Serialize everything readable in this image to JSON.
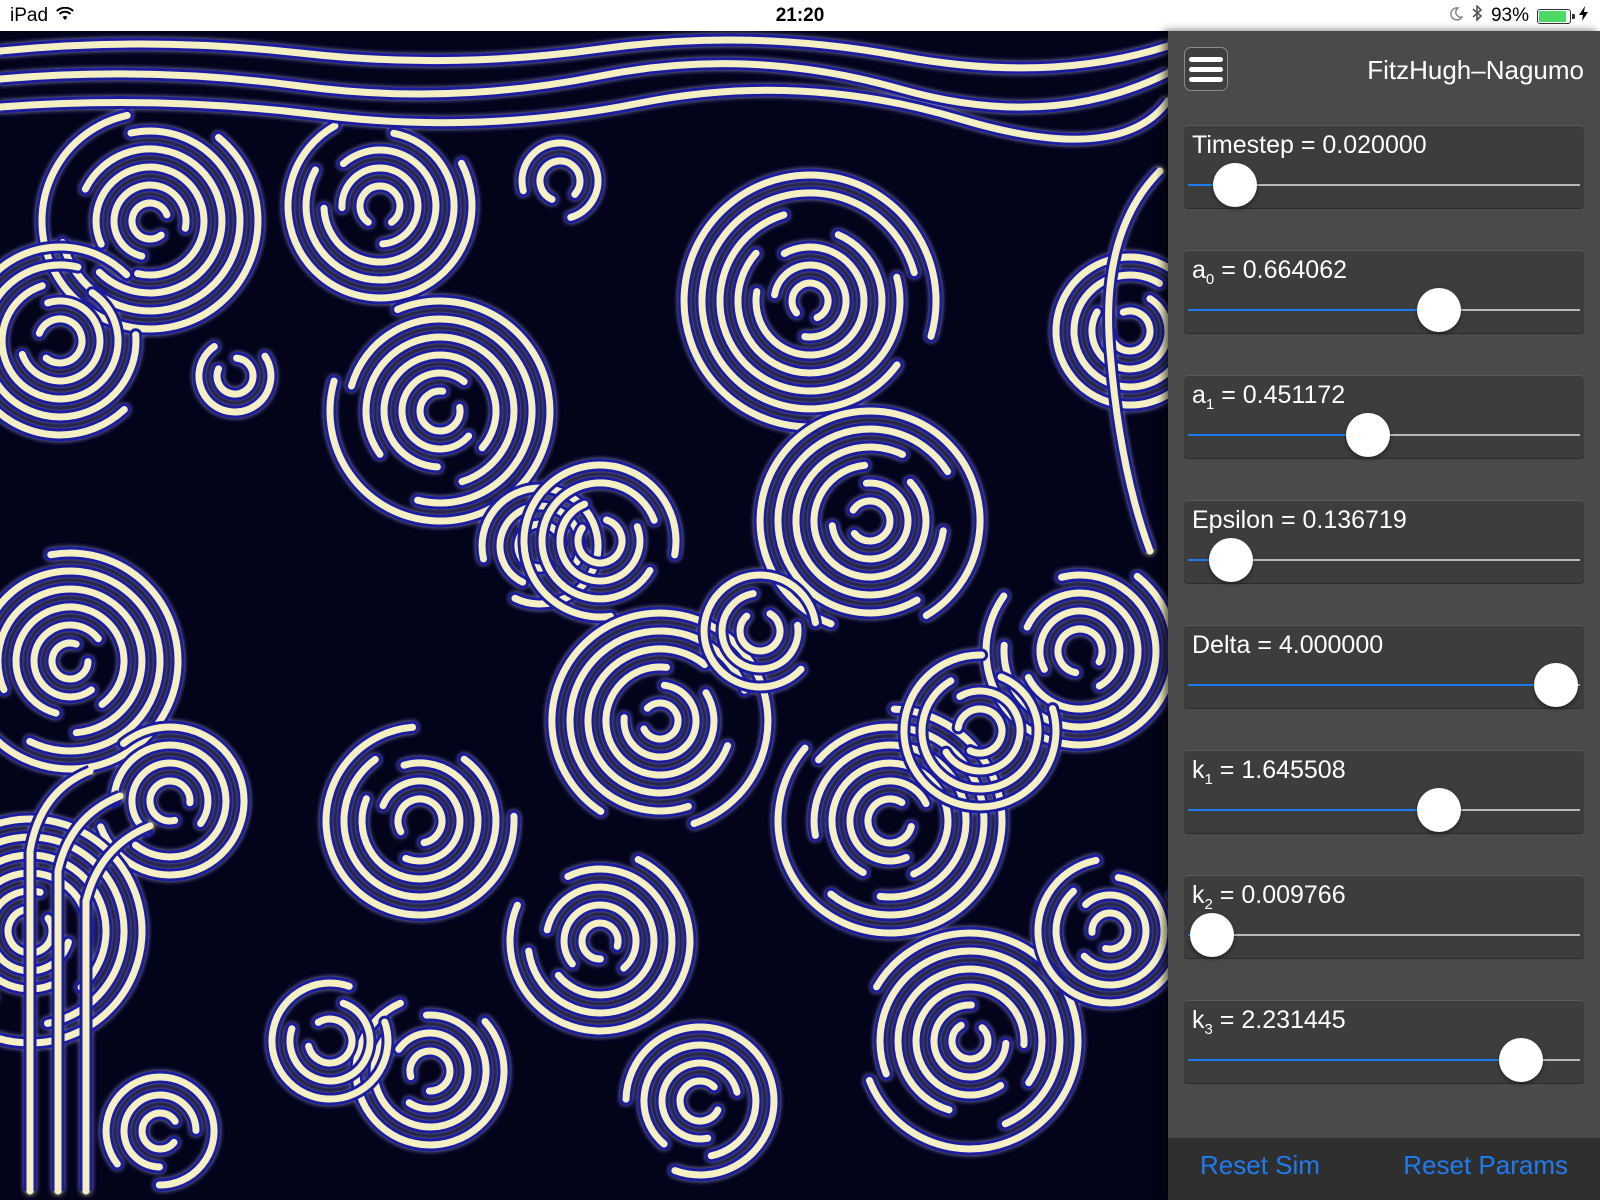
{
  "status_bar": {
    "device": "iPad",
    "time": "21:20",
    "battery_percent": "93%",
    "battery_level": 0.93,
    "icons": [
      "wifi-icon",
      "moon-icon",
      "bluetooth-icon",
      "battery-icon",
      "charging-bolt-icon"
    ]
  },
  "panel": {
    "title": "FitzHugh–Nagumo",
    "menu_icon": "hamburger-menu-icon",
    "params": [
      {
        "name": "Timestep",
        "sub": "",
        "value": "0.020000",
        "level": 0.12
      },
      {
        "name": "a",
        "sub": "0",
        "value": "0.664062",
        "level": 0.64
      },
      {
        "name": "a",
        "sub": "1",
        "value": "0.451172",
        "level": 0.46
      },
      {
        "name": "Epsilon",
        "sub": "",
        "value": "0.136719",
        "level": 0.11
      },
      {
        "name": "Delta",
        "sub": "",
        "value": "4.000000",
        "level": 0.94
      },
      {
        "name": "k",
        "sub": "1",
        "value": "1.645508",
        "level": 0.64
      },
      {
        "name": "k",
        "sub": "2",
        "value": "0.009766",
        "level": 0.06
      },
      {
        "name": "k",
        "sub": "3",
        "value": "2.231445",
        "level": 0.85
      }
    ],
    "footer": {
      "reset_sim": "Reset Sim",
      "reset_params": "Reset Params"
    }
  },
  "colors": {
    "accent": "#1e7cf0",
    "panel_bg": "#4a4a4a",
    "pattern_bg": "#03031a",
    "pattern_line": "#f4f0c4",
    "pattern_glow": "#1a1a9e"
  }
}
